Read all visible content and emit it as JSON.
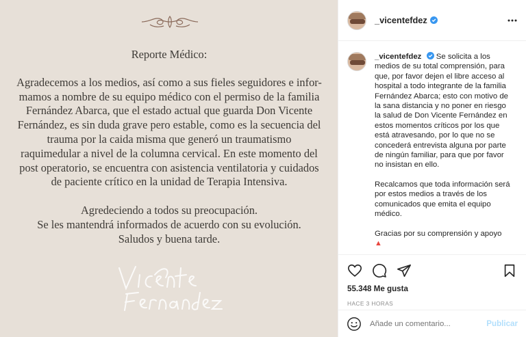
{
  "post": {
    "image": {
      "title": "Reporte Médico:",
      "paragraphs": [
        [
          "Agradecemos a los medios, así como a sus fieles seguidores e infor-",
          "mamos a nombre de su equipo médico con el permiso de la familia",
          "Fernández Abarca, que el estado actual que guarda Don Vicente",
          "Fernández, es sin duda grave pero estable, como es la secuencia del",
          "trauma por la caida misma que generó un traumatismo",
          "raquimedular a nivel de la columna cervical. En este momento del",
          "post operatorio, se encuentra con asistencia ventilatoria y cuidados",
          "de paciente crítico en la unidad de Terapia Intensiva."
        ],
        [
          "Agredeciendo a todos su preocupación.",
          "Se les mantendrá informados de acuerdo con su evolución.",
          "Saludos y buena tarde."
        ]
      ],
      "signature": "Vicente Fernández",
      "background": "#e7e0d8"
    },
    "header": {
      "username": "_vicentefdez",
      "verified_icon": "verified-badge-icon",
      "more_icon": "more-options-icon"
    },
    "caption": {
      "username": "_vicentefdez",
      "paragraphs": [
        [
          "Se solicita a los",
          "medios de su total comprensión, para",
          "que, por favor dejen el libre acceso al",
          "hospital a todo integrante de la familia",
          "Fernández Abarca; esto con motivo de",
          "la sana distancia y no poner en riesgo",
          "la salud de Don Vicente Fernández en",
          "estos momentos críticos por los que",
          "está atravesando, por lo que no se",
          "concederá entrevista alguna por parte",
          "de ningún familiar, para que por favor",
          "no insistan en ello."
        ],
        [
          "Recalcamos que toda información será",
          "por estos medios a través de los",
          "comunicados que emita el equipo",
          "médico."
        ],
        [
          "Gracias por su comprensión y apoyo"
        ]
      ]
    },
    "actions": {
      "like_icon": "heart-icon",
      "comment_icon": "comment-icon",
      "share_icon": "share-icon",
      "save_icon": "bookmark-icon",
      "likes": "55.348 Me gusta",
      "time": "HACE 3 HORAS"
    },
    "comment_box": {
      "emoji_icon": "emoji-icon",
      "placeholder": "Añade un comentario...",
      "publish_label": "Publicar"
    }
  },
  "colors": {
    "publish_disabled": "#b2dffc",
    "verified": "#3897f0",
    "image_text": "#3d3a36"
  }
}
